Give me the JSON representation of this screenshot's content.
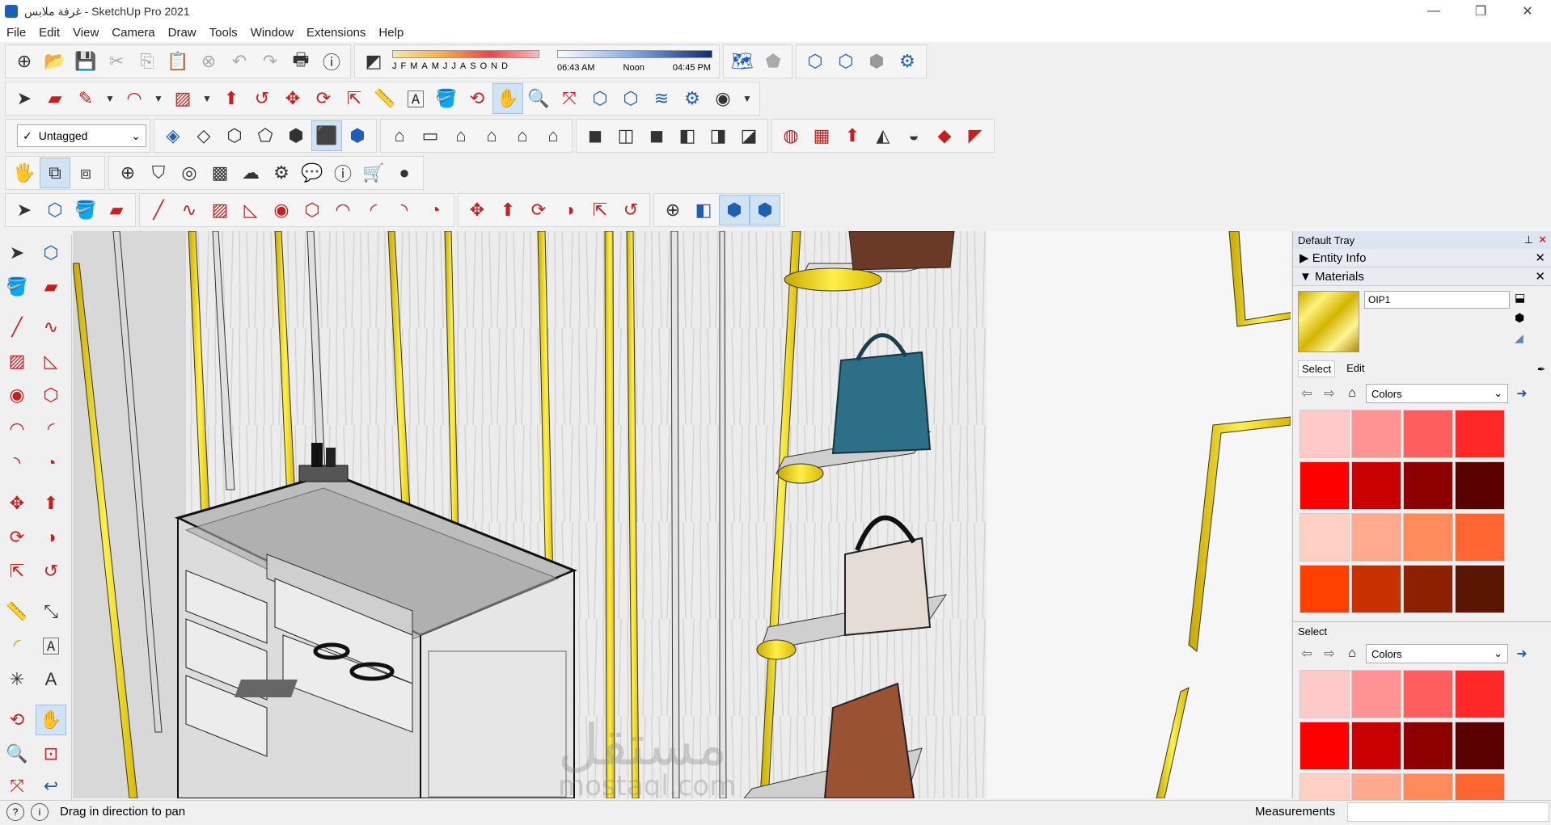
{
  "window": {
    "title": "غرفة ملابس - SketchUp Pro 2021",
    "minimize": "—",
    "maximize": "❐",
    "close": "✕"
  },
  "menu": [
    "File",
    "Edit",
    "View",
    "Camera",
    "Draw",
    "Tools",
    "Window",
    "Extensions",
    "Help"
  ],
  "shadow": {
    "months": [
      "J",
      "F",
      "M",
      "A",
      "M",
      "J",
      "J",
      "A",
      "S",
      "O",
      "N",
      "D"
    ],
    "time_start": "06:43 AM",
    "time_mid": "Noon",
    "time_end": "04:45 PM"
  },
  "tag": {
    "value": "Untagged"
  },
  "tray": {
    "title": "Default Tray",
    "entity_info": "Entity Info",
    "materials": "Materials",
    "material_name": "OIP1",
    "tab_select": "Select",
    "tab_edit": "Edit",
    "library1": "Colors",
    "select2_label": "Select",
    "library2": "Colors",
    "colors1": [
      "#ffc9c9",
      "#ff9393",
      "#ff5e5e",
      "#ff2828",
      "#ff0000",
      "#c80000",
      "#8c0000",
      "#5a0000",
      "#ffd0c3",
      "#ffaa8e",
      "#ff8a5c",
      "#ff6530",
      "#ff4000",
      "#c83000",
      "#8c2000",
      "#5a1500"
    ],
    "colors2": [
      "#ffc9c9",
      "#ff9393",
      "#ff5e5e",
      "#ff2828",
      "#ff0000",
      "#c80000",
      "#8c0000",
      "#5a0000",
      "#ffd0c3",
      "#ffaa8e",
      "#ff8a5c",
      "#ff6530"
    ]
  },
  "status": {
    "message": "Drag in direction to pan",
    "measurements_label": "Measurements"
  },
  "watermark": {
    "arabic": "مستقل",
    "latin": "mostaql.com"
  },
  "colors": {
    "gold_trim": "#f2d200",
    "accent_blue": "#1e5fb4",
    "tool_red": "#c81e1e"
  }
}
